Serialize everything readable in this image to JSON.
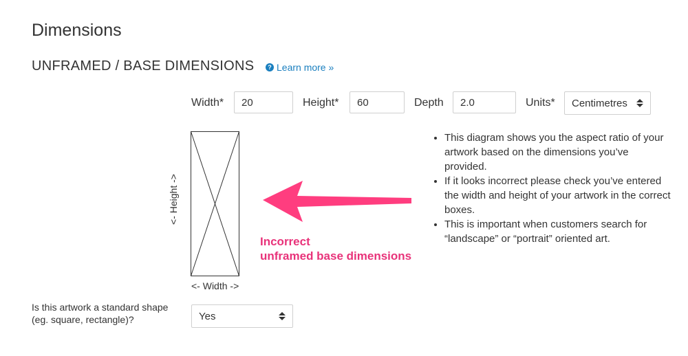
{
  "page": {
    "title": "Dimensions",
    "section_title": "UNFRAMED / BASE DIMENSIONS",
    "learn_more": "Learn more »"
  },
  "form": {
    "width_label": "Width*",
    "width_value": "20",
    "height_label": "Height*",
    "height_value": "60",
    "depth_label": "Depth",
    "depth_value": "2.0",
    "units_label": "Units*",
    "units_value": "Centimetres"
  },
  "diagram": {
    "height_label": "<- Height ->",
    "width_label": "<- Width ->"
  },
  "info_bullets": [
    "This diagram shows you the aspect ratio of your artwork based on the dimensions you’ve provided.",
    "If it looks incorrect please check you’ve entered the width and height of your artwork in the correct boxes.",
    "This is important when customers search for “landscape” or “portrait” oriented art."
  ],
  "annotation": {
    "line1": "Incorrect",
    "line2": "unframed base dimensions"
  },
  "standard_shape": {
    "question": "Is this artwork a standard shape (eg. square, rectangle)?",
    "value": "Yes"
  },
  "colors": {
    "link": "#1a7fbf",
    "annotation": "#e8337a",
    "arrow": "#ff3d7f"
  },
  "icons": {
    "help": "question-circle-icon",
    "select_arrows": "sort-arrows-icon"
  }
}
